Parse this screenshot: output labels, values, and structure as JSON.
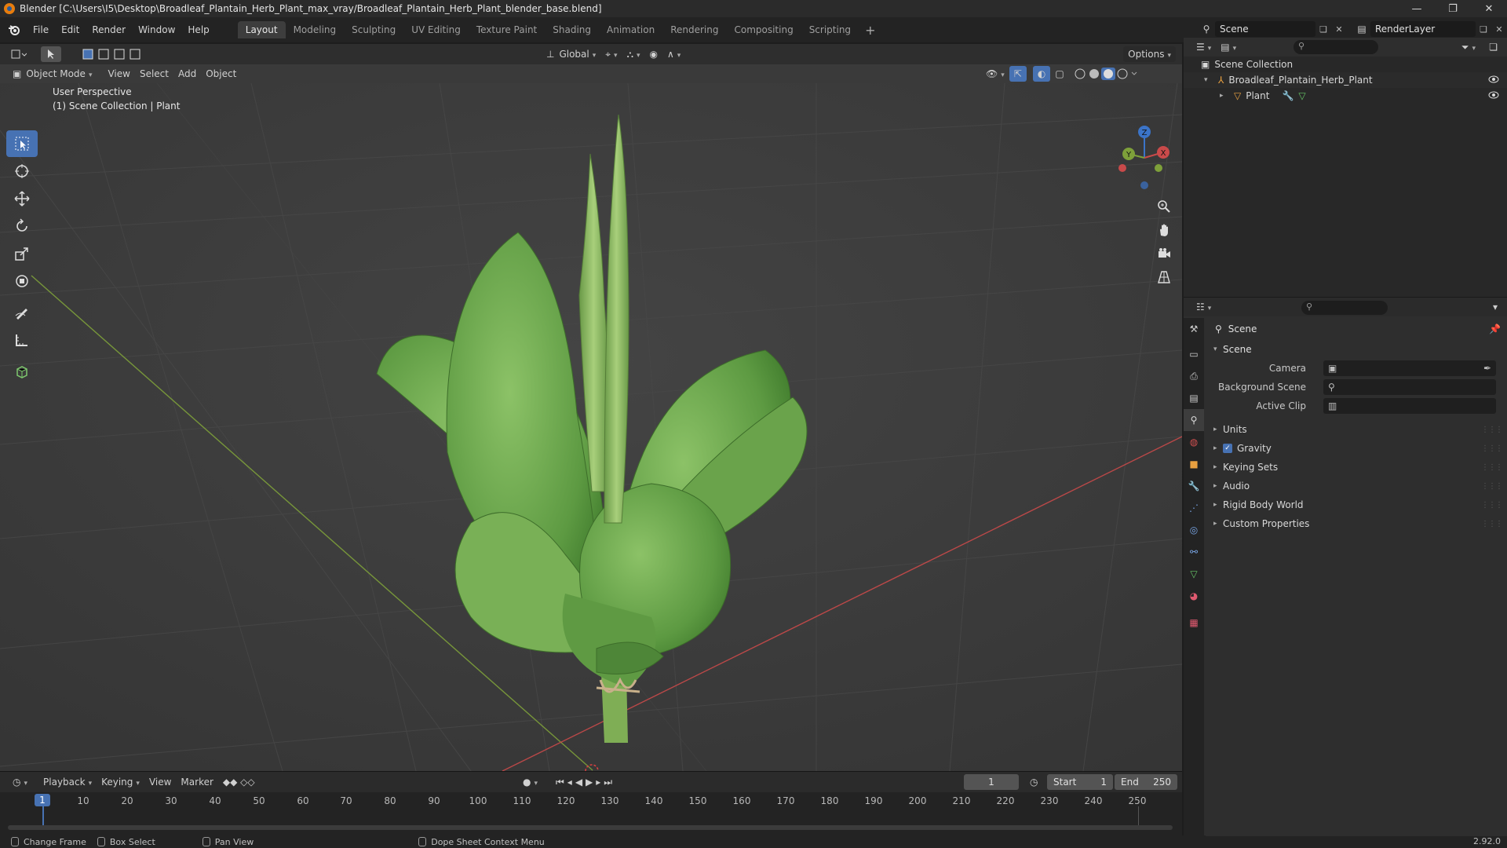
{
  "window": {
    "title": "Blender [C:\\Users\\I5\\Desktop\\Broadleaf_Plantain_Herb_Plant_max_vray/Broadleaf_Plantain_Herb_Plant_blender_base.blend]",
    "controls": [
      "—",
      "❐",
      "✕"
    ]
  },
  "menu": {
    "items": [
      "File",
      "Edit",
      "Render",
      "Window",
      "Help"
    ],
    "workspaces": [
      "Layout",
      "Modeling",
      "Sculpting",
      "UV Editing",
      "Texture Paint",
      "Shading",
      "Animation",
      "Rendering",
      "Compositing",
      "Scripting"
    ],
    "active_workspace": "Layout",
    "scene": "Scene",
    "render_layer": "RenderLayer"
  },
  "viewport": {
    "transform_orientation": "Global",
    "options_label": "Options",
    "mode": "Object Mode",
    "header_menus": [
      "View",
      "Select",
      "Add",
      "Object"
    ],
    "perspective_label": "User Perspective",
    "collection_label": "(1) Scene Collection | Plant",
    "gizmo": {
      "x": "X",
      "y": "Y",
      "z": "Z"
    }
  },
  "timeline": {
    "menus": [
      "Playback",
      "Keying",
      "View",
      "Marker"
    ],
    "current_frame": "1",
    "start_label": "Start",
    "start_value": "1",
    "end_label": "End",
    "end_value": "250",
    "ruler": [
      "10",
      "20",
      "30",
      "40",
      "50",
      "60",
      "70",
      "80",
      "90",
      "100",
      "110",
      "120",
      "130",
      "140",
      "150",
      "160",
      "170",
      "180",
      "190",
      "200",
      "210",
      "220",
      "230",
      "240",
      "250"
    ],
    "cursor_label": "1"
  },
  "statusbar": {
    "items": [
      "Change Frame",
      "Box Select",
      "Pan View",
      "Dope Sheet Context Menu"
    ],
    "version": "2.92.0"
  },
  "outliner": {
    "root": "Scene Collection",
    "rows": [
      {
        "label": "Broadleaf_Plantain_Herb_Plant"
      },
      {
        "label": "Plant"
      }
    ]
  },
  "properties": {
    "crumb": "Scene",
    "panel": "Scene",
    "fields": [
      {
        "label": "Camera"
      },
      {
        "label": "Background Scene"
      },
      {
        "label": "Active Clip"
      }
    ],
    "subpanels": [
      "Units",
      "Gravity",
      "Keying Sets",
      "Audio",
      "Rigid Body World",
      "Custom Properties"
    ],
    "gravity_checked": true
  },
  "colors": {
    "accent": "#4772b3",
    "viewport_bg": "#3a3a3a",
    "leaf": "#6fa84e",
    "x_axis": "#c94a4a",
    "y_axis": "#7ea03a",
    "z_axis": "#3b74c8"
  }
}
